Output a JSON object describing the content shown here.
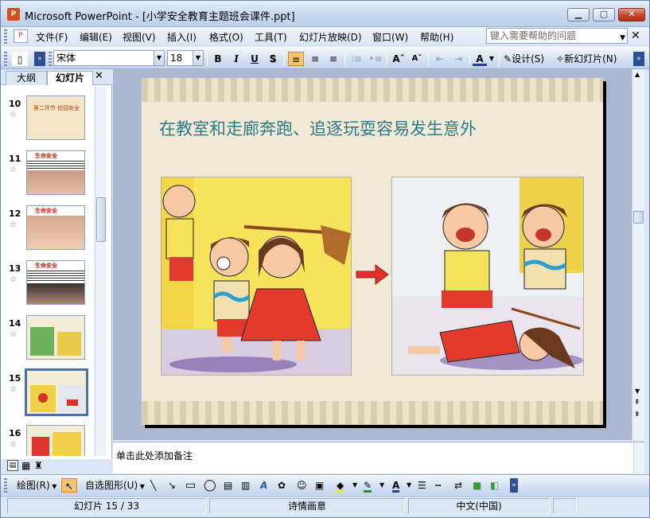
{
  "window": {
    "title": "Microsoft PowerPoint - [小学安全教育主题班会课件.ppt]",
    "app_badge": "P"
  },
  "menu": {
    "items": [
      "文件(F)",
      "编辑(E)",
      "视图(V)",
      "插入(I)",
      "格式(O)",
      "工具(T)",
      "幻灯片放映(D)",
      "窗口(W)",
      "帮助(H)"
    ],
    "help_placeholder": "键入需要帮助的问题"
  },
  "toolbar": {
    "font_name": "宋体",
    "font_size": "18",
    "bold": "B",
    "italic": "I",
    "underline": "U",
    "shadow": "S",
    "design_label": "设计(S)",
    "new_slide_label": "新幻灯片(N)"
  },
  "left_panel": {
    "tab_outline": "大纲",
    "tab_slides": "幻灯片",
    "slides": [
      {
        "num": "10",
        "mini": "第二环节 校园安全"
      },
      {
        "num": "11",
        "mini": "生命安全"
      },
      {
        "num": "12",
        "mini": "生命安全"
      },
      {
        "num": "13",
        "mini": "生命安全"
      },
      {
        "num": "14",
        "mini": ""
      },
      {
        "num": "15",
        "mini": ""
      },
      {
        "num": "16",
        "mini": ""
      }
    ],
    "selected_slide": "15"
  },
  "slide": {
    "title": "在教室和走廊奔跑、追逐玩耍容易发生意外"
  },
  "notes": {
    "placeholder": "单击此处添加备注"
  },
  "drawbar": {
    "draw_label": "绘图(R)",
    "autoshapes_label": "自选图形(U)"
  },
  "status": {
    "slide_position": "幻灯片 15 / 33",
    "design_name": "诗情画意",
    "language": "中文(中国)"
  },
  "colors": {
    "title_teal": "#2d7a86",
    "slide_bg": "#f2ead6",
    "selection": "#4f6fa8"
  }
}
